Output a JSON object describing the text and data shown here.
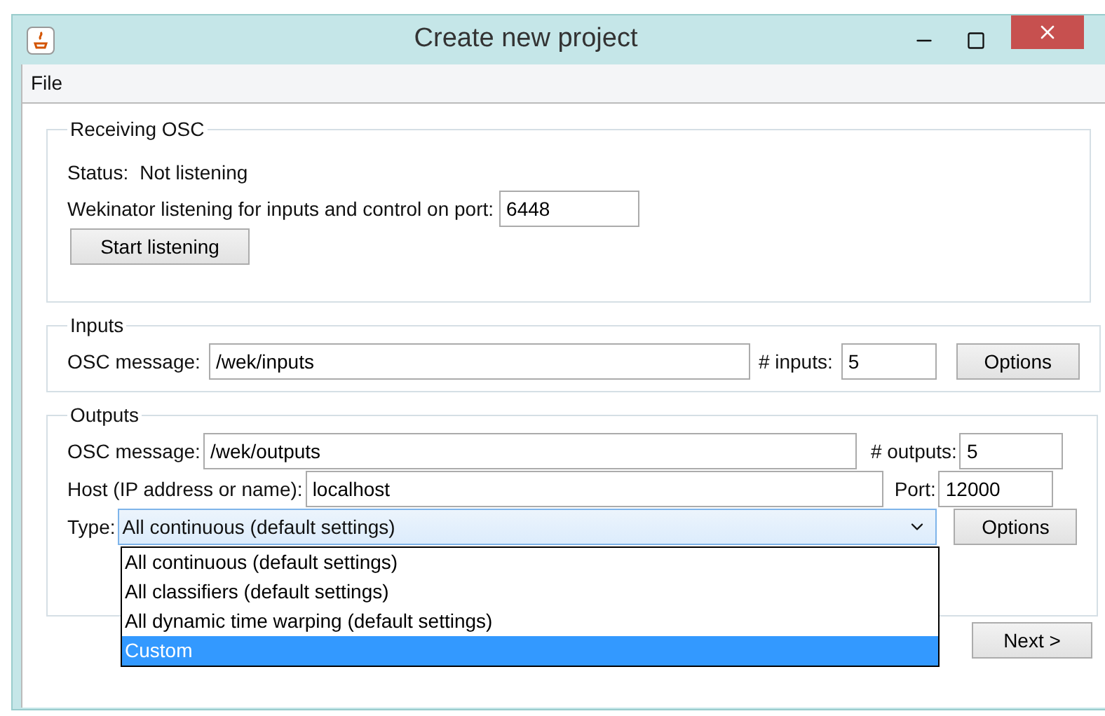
{
  "window": {
    "title": "Create new project"
  },
  "menu": [
    "File"
  ],
  "receiving": {
    "title": "Receiving OSC",
    "status_label": "Status:",
    "status": "Not listening",
    "port_label": "Wekinator listening for inputs and control on port:",
    "port": "6448",
    "button": "Start listening"
  },
  "inputs": {
    "title": "Inputs",
    "message_label": "OSC message:",
    "message": "/wek/inputs",
    "count_label": "# inputs:",
    "count": "5",
    "button": "Options"
  },
  "outputs": {
    "title": "Outputs",
    "message_label": "OSC message:",
    "message": "/wek/outputs",
    "count_label": "# outputs:",
    "count": "5",
    "host_label": "Host (IP address or name):",
    "host": "localhost",
    "port_label": "Port:",
    "port": "12000",
    "type_label": "Type:",
    "type": "All continuous (default settings)",
    "button": "Options",
    "options": [
      {
        "label": "All continuous (default settings)",
        "selected": false
      },
      {
        "label": "All classifiers (default settings)",
        "selected": false
      },
      {
        "label": "All dynamic time warping (default settings)",
        "selected": false
      },
      {
        "label": "Custom",
        "selected": true
      }
    ]
  },
  "next_button": "Next >"
}
